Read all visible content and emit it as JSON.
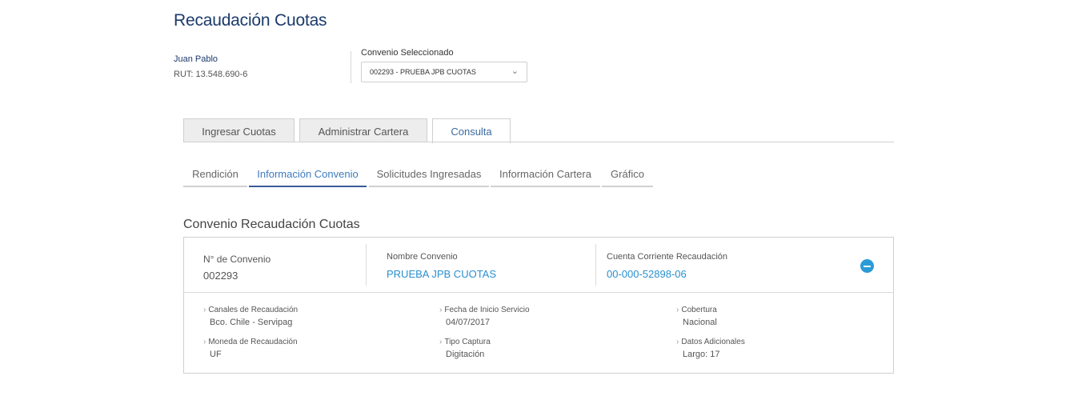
{
  "page_title": "Recaudación Cuotas",
  "user": {
    "name": "Juan Pablo",
    "rut": "RUT: 13.548.690-6"
  },
  "convenio_select": {
    "label": "Convenio Seleccionado",
    "value": "002293 - PRUEBA JPB CUOTAS",
    "icon": "chevron-down-icon"
  },
  "tabs": [
    {
      "label": "Ingresar Cuotas",
      "active": false
    },
    {
      "label": "Administrar Cartera",
      "active": false
    },
    {
      "label": "Consulta",
      "active": true
    }
  ],
  "subtabs": [
    {
      "label": "Rendición",
      "active": false
    },
    {
      "label": "Información Convenio",
      "active": true
    },
    {
      "label": "Solicitudes Ingresadas",
      "active": false
    },
    {
      "label": "Información Cartera",
      "active": false
    },
    {
      "label": "Gráfico",
      "active": false
    }
  ],
  "section_title": "Convenio Recaudación Cuotas",
  "summary": {
    "numero_label": "N° de Convenio",
    "numero_value": "002293",
    "nombre_label": "Nombre Convenio",
    "nombre_value": "PRUEBA JPB CUOTAS",
    "cuenta_label": "Cuenta Corriente Recaudación",
    "cuenta_value": "00-000-52898-06",
    "collapse_icon": "minus-circle-icon"
  },
  "details": {
    "canales_label": "Canales de Recaudación",
    "canales_value": "Bco. Chile - Servipag",
    "fecha_label": "Fecha de Inicio Servicio",
    "fecha_value": "04/07/2017",
    "cobertura_label": "Cobertura",
    "cobertura_value": "Nacional",
    "moneda_label": "Moneda de Recaudación",
    "moneda_value": "UF",
    "tipo_label": "Tipo Captura",
    "tipo_value": "Digitación",
    "datos_label": "Datos Adicionales",
    "datos_value": "Largo: 17",
    "arrow_icon": "chevron-right-icon"
  },
  "colors": {
    "title": "#1b3a6b",
    "link": "#2a8fcf",
    "accent": "#2b9bd7",
    "active_tab_underline": "#3a5a9a"
  }
}
